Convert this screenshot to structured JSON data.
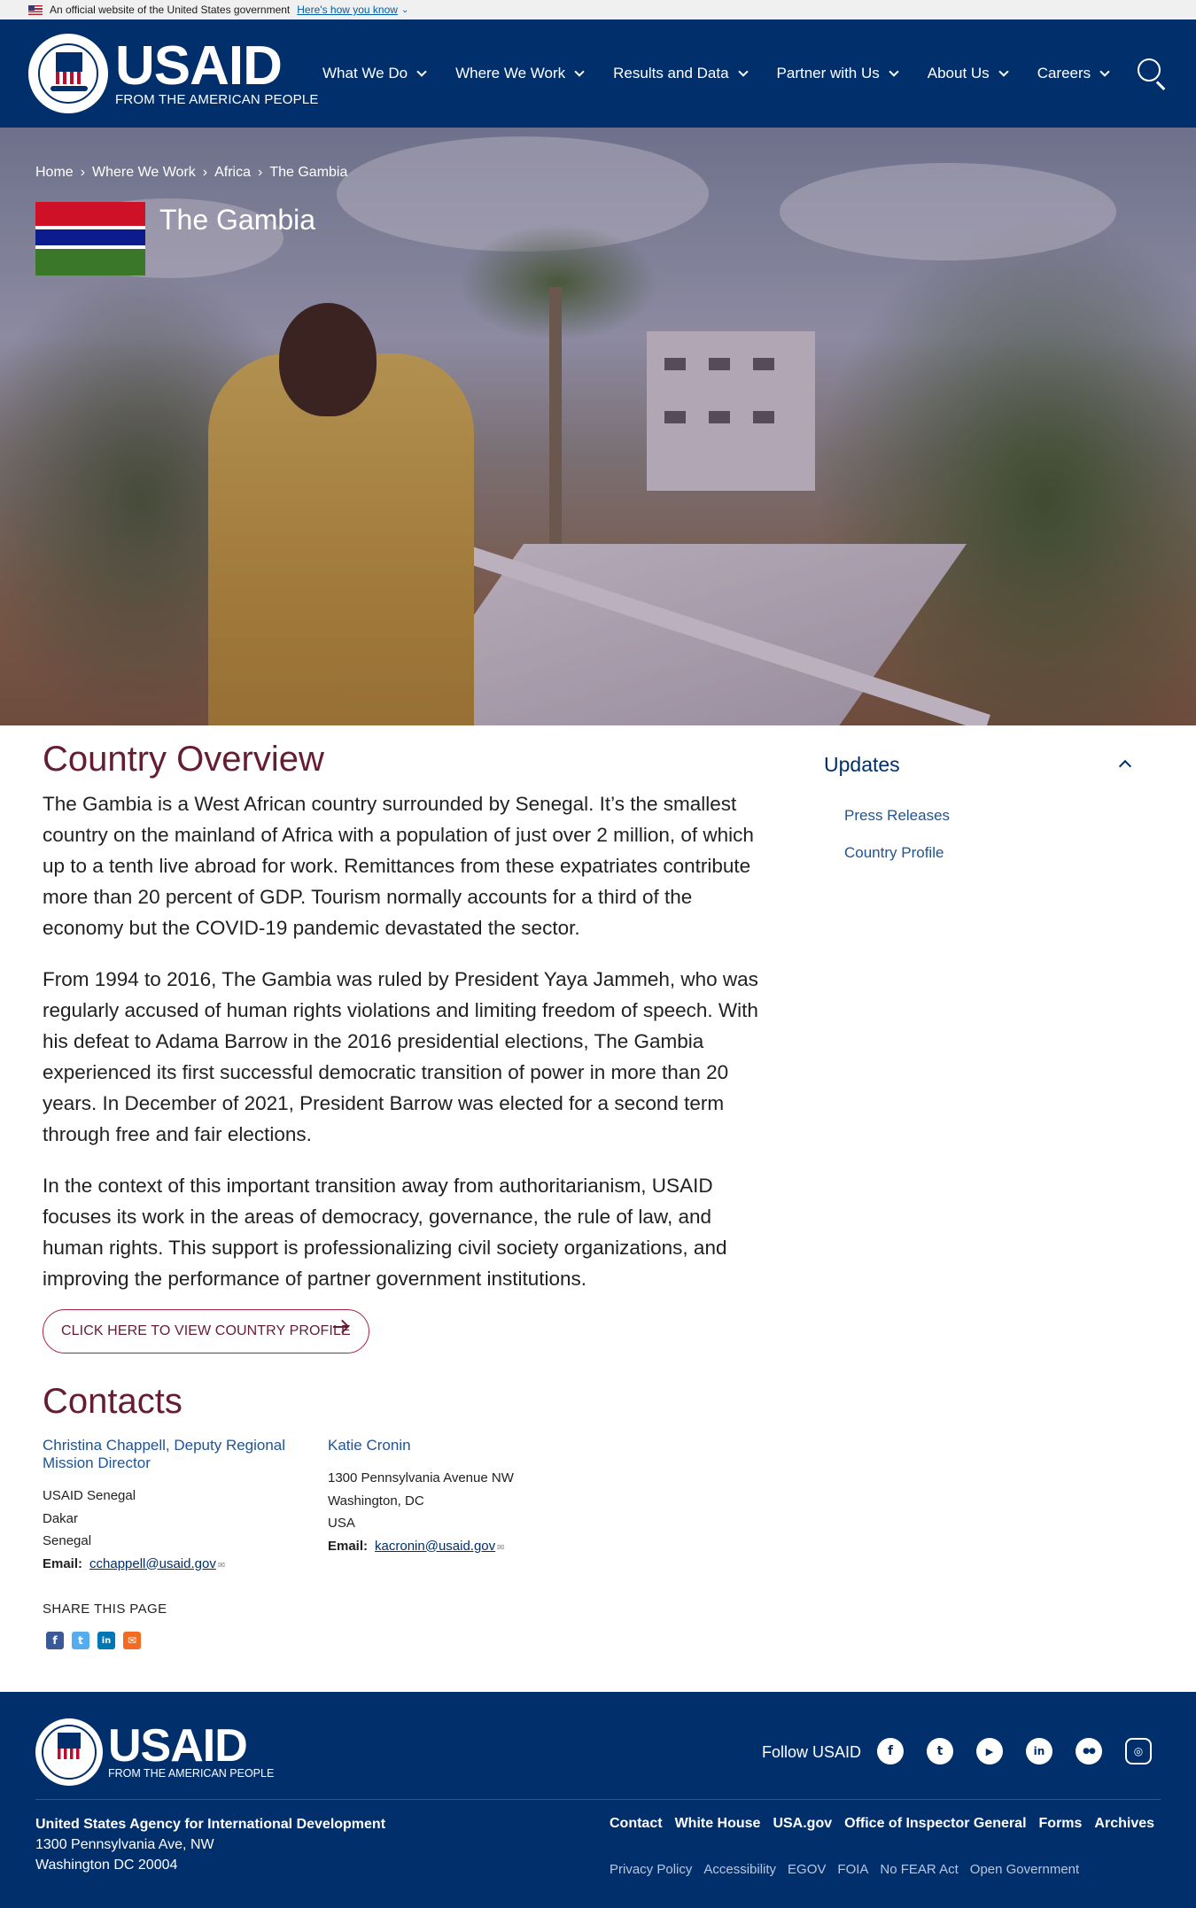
{
  "gov_banner": {
    "text": "An official website of the United States government",
    "how_link": "Here's how you know"
  },
  "header": {
    "logo_word": "USAID",
    "logo_tagline": "FROM THE AMERICAN PEOPLE",
    "nav": [
      {
        "label": "What We Do"
      },
      {
        "label": "Where We Work"
      },
      {
        "label": "Results and Data"
      },
      {
        "label": "Partner with Us"
      },
      {
        "label": "About Us"
      },
      {
        "label": "Careers"
      }
    ],
    "search_icon": "search-icon"
  },
  "hero": {
    "breadcrumb": [
      "Home",
      "Where We Work",
      "Africa",
      "The Gambia"
    ],
    "country_name": "The Gambia",
    "flag_colors": [
      "#ce1126",
      "#ffffff",
      "#0c1c8c",
      "#ffffff",
      "#3a7728"
    ]
  },
  "overview": {
    "title": "Country Overview",
    "paragraphs": [
      "The Gambia is a West African country surrounded by Senegal. It’s the smallest country on the mainland of Africa with a population of just over 2 million, of which up to a tenth live abroad for work. Remittances from these expatriates contribute more than 20 percent of GDP.  Tourism normally accounts for a third of the economy but the COVID-19 pandemic devastated the sector.",
      "From 1994 to 2016, The Gambia was ruled by President Yaya Jammeh, who was regularly accused of human rights violations and limiting freedom of speech. With his defeat to Adama Barrow in the 2016 presidential elections, The Gambia experienced its first successful democratic transition of power in more than 20 years. In December of 2021, President Barrow was elected for a second term  through free and fair elections.",
      "In the context of this important transition away from authoritarianism, USAID focuses its work in the areas of democracy, governance, the rule of law, and human rights. This support is professionalizing civil society organizations, and improving the performance of partner government institutions."
    ],
    "profile_button": "CLICK HERE TO VIEW COUNTRY PROFILE"
  },
  "sidebar": {
    "title": "Updates",
    "links": [
      "Press Releases",
      "Country Profile"
    ]
  },
  "contacts": {
    "title": "Contacts",
    "people": [
      {
        "name": "Christina Chappell, Deputy Regional Mission Director",
        "lines": [
          "USAID Senegal",
          "Dakar",
          "Senegal"
        ],
        "email_label": "Email:",
        "email": "cchappell@usaid.gov"
      },
      {
        "name": "Katie Cronin",
        "lines": [
          "1300 Pennsylvania Avenue NW",
          "Washington, DC",
          "USA"
        ],
        "email_label": "Email:",
        "email": "kacronin@usaid.gov"
      }
    ]
  },
  "share": {
    "label": "SHARE THIS PAGE",
    "icons": [
      {
        "name": "facebook-icon",
        "glyph": "f",
        "color": "#3b5998"
      },
      {
        "name": "twitter-icon",
        "glyph": "t",
        "color": "#55acee"
      },
      {
        "name": "linkedin-icon",
        "glyph": "in",
        "color": "#0077b5"
      },
      {
        "name": "email-icon",
        "glyph": "✉",
        "color": "#f26b21"
      }
    ]
  },
  "footer": {
    "logo_word": "USAID",
    "logo_tagline": "FROM THE AMERICAN PEOPLE",
    "follow_label": "Follow USAID",
    "social": [
      {
        "name": "facebook-icon",
        "glyph": "f"
      },
      {
        "name": "twitter-icon",
        "glyph": "t"
      },
      {
        "name": "youtube-icon",
        "glyph": "▶"
      },
      {
        "name": "linkedin-icon",
        "glyph": "in"
      },
      {
        "name": "flickr-icon",
        "glyph": "●●"
      },
      {
        "name": "instagram-icon",
        "glyph": "◎"
      }
    ],
    "org_name": "United States Agency for International Development",
    "address_line1": "1300 Pennsylvania Ave, NW",
    "address_line2": "Washington DC 20004",
    "links": [
      "Contact",
      "White House",
      "USA.gov",
      "Office of Inspector General",
      "Forms",
      "Archives"
    ],
    "sub_links": [
      "Privacy Policy",
      "Accessibility",
      "EGOV",
      "FOIA",
      "No FEAR Act",
      "Open Government"
    ]
  },
  "colors": {
    "navy": "#002f6c",
    "heading_red": "#651d32",
    "link_blue": "#205493"
  }
}
